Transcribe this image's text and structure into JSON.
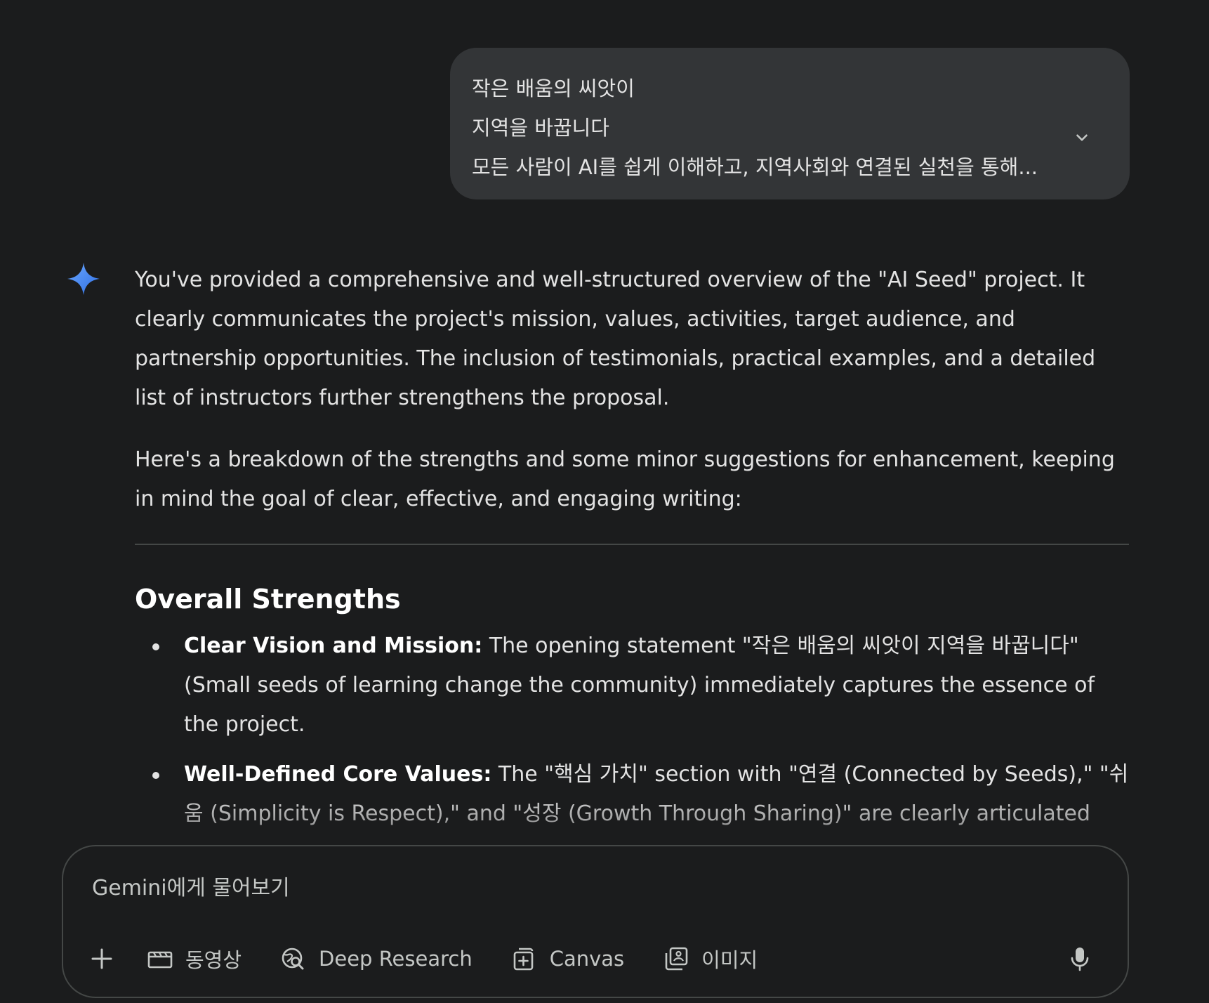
{
  "user_prompt": {
    "lines": [
      "작은 배움의 씨앗이",
      "지역을 바꿉니다",
      "모든 사람이 AI를 쉽게 이해하고, 지역사회와 연결된 실천을 통해..."
    ],
    "expand_icon": "chevron-down-icon"
  },
  "response": {
    "avatar_icon": "gemini-spark-icon",
    "paragraph1": "You've provided a comprehensive and well-structured overview of the \"AI Seed\" project. It clearly communicates the project's mission, values, activities, target audience, and partnership opportunities. The inclusion of testimonials, practical examples, and a detailed list of instructors further strengthens the proposal.",
    "paragraph2": "Here's a breakdown of the strengths and some minor suggestions for enhancement, keeping in mind the goal of clear, effective, and engaging writing:",
    "section_title": "Overall Strengths",
    "bullets": [
      {
        "title": "Clear Vision and Mission:",
        "text": " The opening statement \"작은 배움의 씨앗이 지역을 바꿉니다\" (Small seeds of learning change the community) immediately captures the essence of the project."
      },
      {
        "title": "Well-Defined Core Values:",
        "text": " The \"핵심 가치\" section with \"연결 (Connected by Seeds),\" \"쉬움 (Simplicity is Respect),\" and \"성장 (Growth Through Sharing)\" are clearly articulated and supported by relevant descriptions and icons."
      }
    ]
  },
  "input": {
    "placeholder": "Gemini에게 물어보기",
    "tools": {
      "add": "plus-icon",
      "video_label": "동영상",
      "deep_research_label": "Deep Research",
      "canvas_label": "Canvas",
      "image_label": "이미지"
    },
    "mic_icon": "microphone-icon"
  },
  "colors": {
    "background": "#1b1c1d",
    "bubble": "#333537",
    "text": "#e3e3e3",
    "muted": "#c4c7c5",
    "border": "#444746",
    "spark_blue": "#4285f4"
  }
}
